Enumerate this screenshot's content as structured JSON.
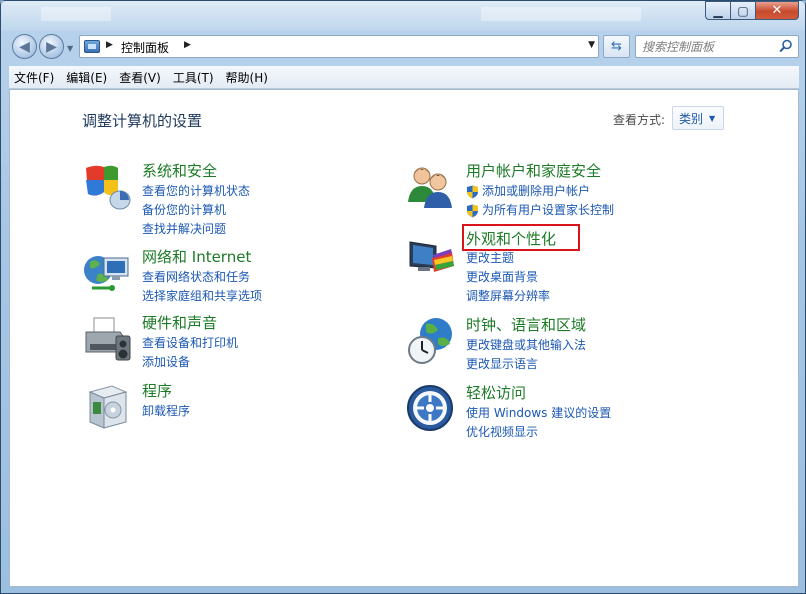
{
  "window": {
    "address_title": "控制面板",
    "search_placeholder": "搜索控制面板"
  },
  "menu": [
    "文件(F)",
    "编辑(E)",
    "查看(V)",
    "工具(T)",
    "帮助(H)"
  ],
  "page": {
    "title": "调整计算机的设置",
    "view_by_label": "查看方式:",
    "view_by_value": "类别"
  },
  "categories": {
    "system_security": {
      "title": "系统和安全",
      "links": [
        "查看您的计算机状态",
        "备份您的计算机",
        "查找并解决问题"
      ]
    },
    "network": {
      "title": "网络和 Internet",
      "links": [
        "查看网络状态和任务",
        "选择家庭组和共享选项"
      ]
    },
    "hardware": {
      "title": "硬件和声音",
      "links": [
        "查看设备和打印机",
        "添加设备"
      ]
    },
    "programs": {
      "title": "程序",
      "links": [
        "卸载程序"
      ]
    },
    "user_accounts": {
      "title": "用户帐户和家庭安全",
      "links": [
        "添加或删除用户帐户",
        "为所有用户设置家长控制"
      ]
    },
    "appearance": {
      "title": "外观和个性化",
      "links": [
        "更改主题",
        "更改桌面背景",
        "调整屏幕分辨率"
      ]
    },
    "clock_region": {
      "title": "时钟、语言和区域",
      "links": [
        "更改键盘或其他输入法",
        "更改显示语言"
      ]
    },
    "ease_access": {
      "title": "轻松访问",
      "links": [
        "使用 Windows 建议的设置",
        "优化视频显示"
      ]
    }
  },
  "colors": {
    "category_title": "#1d7a26",
    "link": "#1c58b4",
    "highlight": "#d9141a"
  }
}
